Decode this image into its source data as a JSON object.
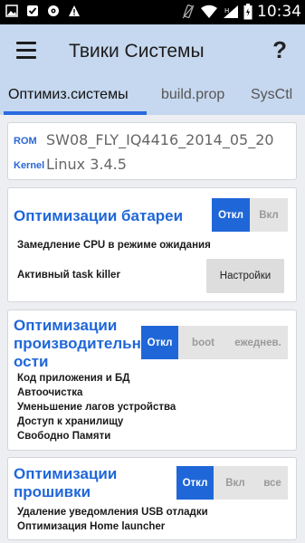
{
  "statusbar": {
    "time": "10:34",
    "icons": [
      "image-notification-icon",
      "checkbox-notification-icon",
      "disc-notification-icon",
      "warning-notification-icon",
      "vibrate-icon",
      "wifi-icon",
      "signal-icon",
      "battery-icon"
    ]
  },
  "appbar": {
    "title": "Твики Системы",
    "menu_icon": "hamburger-menu-icon",
    "help_label": "?"
  },
  "tabs": [
    {
      "label": "Оптимиз.системы",
      "active": true
    },
    {
      "label": "build.prop",
      "active": false
    },
    {
      "label": "SysCtl",
      "active": false
    }
  ],
  "rom_info": {
    "rom_key": "ROM",
    "rom_value": "SW08_FLY_IQ4416_2014_05_20",
    "kernel_key": "Kernel",
    "kernel_value": "Linux 3.4.5"
  },
  "battery": {
    "title": "Оптимизации батареи",
    "toggle": {
      "off": "Откл",
      "on": "Вкл",
      "selected": "Откл"
    },
    "items": [
      "Замедление CPU в режиме ожидания",
      "Активный task killer"
    ],
    "settings_label": "Настройки"
  },
  "performance": {
    "title_lines": [
      "Оптимизации",
      "производительн",
      "ости"
    ],
    "toggle": {
      "off": "Откл",
      "boot": "boot",
      "daily": "ежеднев.",
      "selected": "Откл"
    },
    "items": [
      "Код приложения и БД",
      "Автоочистка",
      "Уменьшение лагов устройства",
      "Доступ к хранилищу",
      "Свободно Памяти"
    ]
  },
  "firmware": {
    "title_lines": [
      "Оптимизации",
      "прошивки"
    ],
    "toggle": {
      "off": "Откл",
      "on": "Вкл",
      "all": "все",
      "selected": "Откл"
    },
    "items": [
      "Удаление уведомления USB отладки",
      "Оптимизация Home launcher"
    ]
  },
  "colors": {
    "accent": "#1f67d8",
    "appbar": "#c6d8ef",
    "background": "#eceef1"
  }
}
